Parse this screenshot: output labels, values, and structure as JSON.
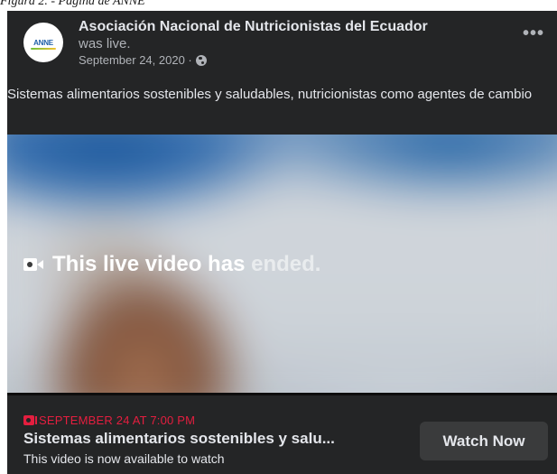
{
  "caption": "Figura 2. - Página de ANNE",
  "post": {
    "avatar_logo_text": "ANNE",
    "page_name": "Asociación Nacional de Nutricionistas del Ecuador",
    "status": "was live.",
    "date": "September 24, 2020 ·",
    "privacy_icon": "globe-icon",
    "more_icon": "more-options-icon",
    "more_label": "•••",
    "text": "Sistemas alimentarios sostenibles y saludables, nutricionistas como agentes de cambio"
  },
  "video": {
    "ended_icon": "video-camera-icon",
    "ended_text": "This live video has",
    "ended_text_faded": "ended."
  },
  "event": {
    "date_icon": "calendar-icon",
    "date_label": "SEPTEMBER 24 AT 7:00 PM",
    "title": "Sistemas alimentarios sostenibles y salu...",
    "subtitle": "This video is now available to watch",
    "watch_button": "Watch Now"
  },
  "colors": {
    "card_bg": "#242526",
    "text_primary": "#e4e6eb",
    "text_secondary": "#b0b3b8",
    "accent_red": "#e41e3f",
    "button_bg": "#3a3b3c"
  }
}
